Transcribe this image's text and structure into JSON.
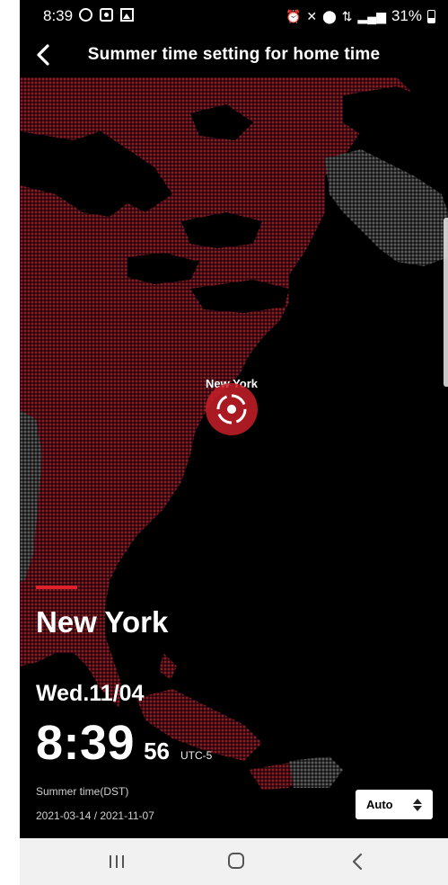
{
  "status_bar": {
    "time": "8:39",
    "battery": "31%",
    "left_icons": [
      "sync-icon",
      "record-icon",
      "gallery-icon"
    ],
    "right_icons": [
      "alarm-icon",
      "mute-icon",
      "location-icon",
      "data-icon",
      "signal-icon",
      "battery-icon"
    ]
  },
  "header": {
    "title": "Summer time setting for home time",
    "back_icon": "chevron-left-icon"
  },
  "map": {
    "pin_label": "New York",
    "land_color": "#8b1d27",
    "other_land_color": "#5c5c5c",
    "water_color": "#000000"
  },
  "info": {
    "city": "New York",
    "date": "Wed.11/04",
    "time_hm": "8:39",
    "time_sec": "56",
    "utc": "UTC-5",
    "dst_label": "Summer time(DST)",
    "dst_range": "2021-03-14 / 2021-11-07",
    "dst_mode": "Auto",
    "accent_color": "#e0202a"
  },
  "nav_bar": {
    "buttons": [
      "recent-apps",
      "home",
      "back"
    ]
  }
}
